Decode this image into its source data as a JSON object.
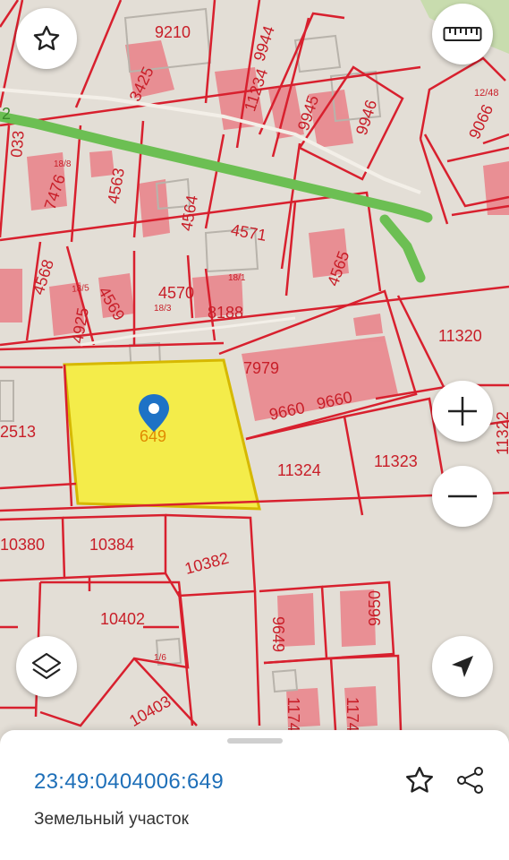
{
  "map": {
    "parcel_labels": [
      "9210",
      "9944",
      "11234",
      "9945",
      "9946",
      "3425",
      "12/48",
      "9066",
      "7476",
      "4563",
      "4564",
      "4571",
      "4568",
      "4925",
      "4569",
      "4570",
      "8188",
      "4565",
      "11320",
      "7979",
      "9660",
      "9660",
      "2513",
      "649",
      "11324",
      "11323",
      "11322",
      "10380",
      "10384",
      "10382",
      "10402",
      "10403",
      "9649",
      "9650",
      "1174",
      "1174",
      "033",
      "2",
      "18/1",
      "18/5",
      "18/3",
      "18/8",
      "1/6"
    ],
    "selected_parcel_label": "649",
    "colors": {
      "background": "#e3ded6",
      "boundary": "#d8202e",
      "building": "#e98a90",
      "selected_fill": "#f4ec4a",
      "road_green": "#6cbf53",
      "pin": "#1e72c6"
    }
  },
  "controls": {
    "favorite_icon": "star-outline-icon",
    "ruler_icon": "ruler-icon",
    "zoom_in_icon": "plus-icon",
    "zoom_out_icon": "minus-icon",
    "layers_icon": "layers-icon",
    "locate_icon": "navigation-arrow-icon"
  },
  "sheet": {
    "cadastral_number": "23:49:0404006:649",
    "object_type": "Земельный участок",
    "favorite_icon": "star-outline-icon",
    "share_icon": "share-icon"
  }
}
